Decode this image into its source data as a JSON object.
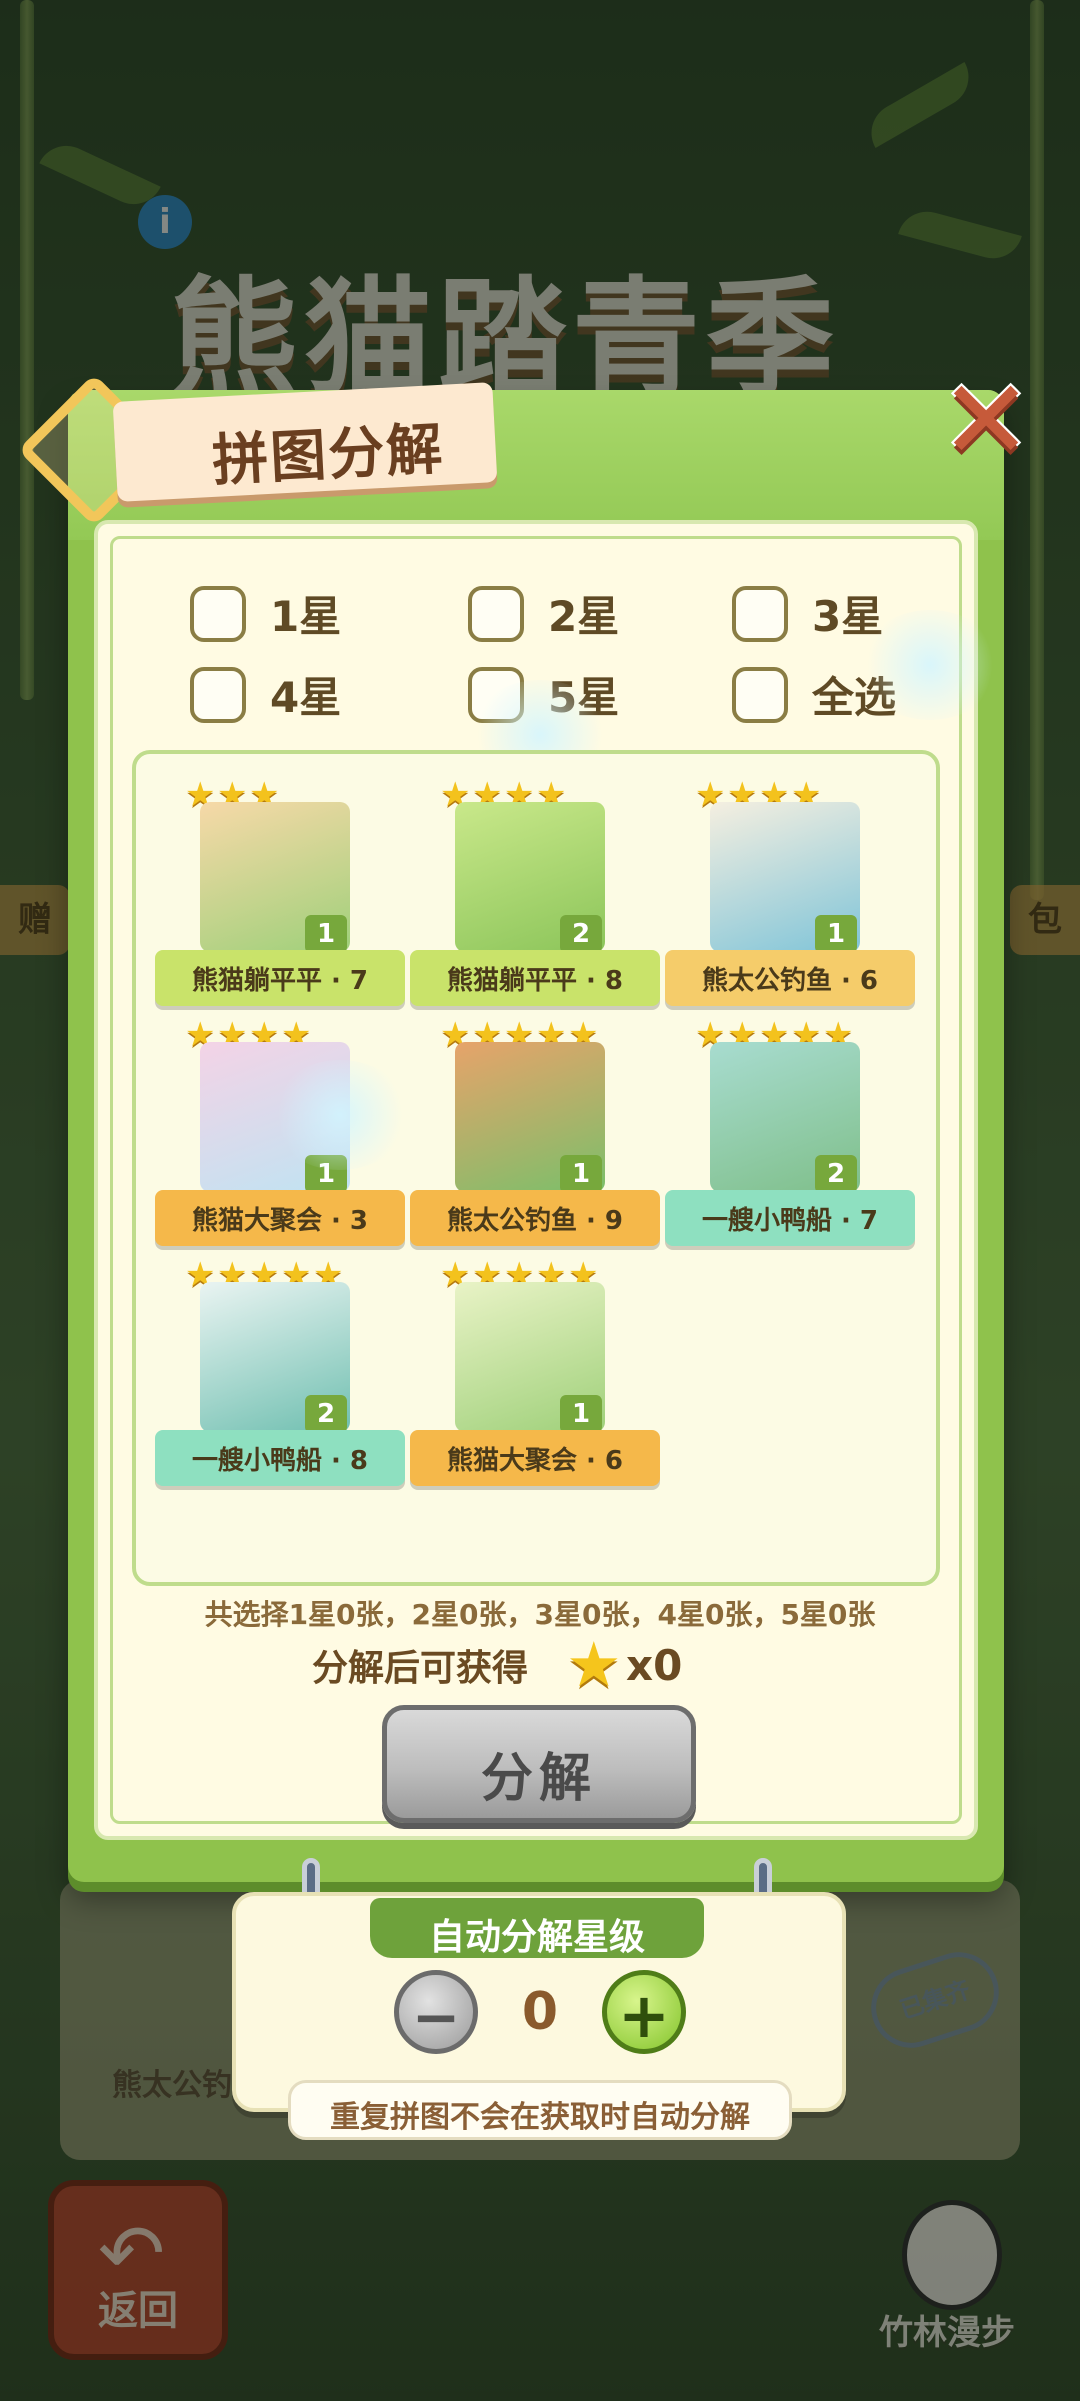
{
  "background": {
    "game_title": "熊猫踏青季",
    "info_icon": "info-icon",
    "left_side_label": "赠",
    "right_side_label": "包",
    "stamp_text": "已集齐",
    "card_label": "熊太公钓"
  },
  "dialog": {
    "title": "拼图分解",
    "close_icon": "close-x-icon",
    "filters": [
      {
        "label": "1星",
        "checked": false
      },
      {
        "label": "2星",
        "checked": false
      },
      {
        "label": "3星",
        "checked": false
      },
      {
        "label": "4星",
        "checked": false
      },
      {
        "label": "5星",
        "checked": false
      },
      {
        "label": "全选",
        "checked": false
      }
    ],
    "cards": [
      {
        "name": "熊猫躺平平 · 7",
        "stars": 3,
        "count": "1",
        "ribbon": "#c9e36a"
      },
      {
        "name": "熊猫躺平平 · 8",
        "stars": 4,
        "count": "2",
        "ribbon": "#c9e36a"
      },
      {
        "name": "熊太公钓鱼 · 6",
        "stars": 4,
        "count": "1",
        "ribbon": "#f5cc6a"
      },
      {
        "name": "熊猫大聚会 · 3",
        "stars": 4,
        "count": "1",
        "ribbon": "#f5b84a"
      },
      {
        "name": "熊太公钓鱼 · 9",
        "stars": 5,
        "count": "1",
        "ribbon": "#f5b84a"
      },
      {
        "name": "一艘小鸭船 · 7",
        "stars": 5,
        "count": "2",
        "ribbon": "#8ee0c0"
      },
      {
        "name": "一艘小鸭船 · 8",
        "stars": 5,
        "count": "2",
        "ribbon": "#8ee0c0"
      },
      {
        "name": "熊猫大聚会 · 6",
        "stars": 5,
        "count": "1",
        "ribbon": "#f5b84a"
      }
    ],
    "summary": "共选择1星0张，2星0张，3星0张，4星0张，5星0张",
    "gain_label": "分解后可获得",
    "gain_icon": "star-icon",
    "gain_value": "x0",
    "decompose_button": "分解"
  },
  "auto_decompose": {
    "title": "自动分解星级",
    "value": "0",
    "minus_icon": "minus-icon",
    "plus_icon": "plus-icon",
    "note": "重复拼图不会在获取时自动分解"
  },
  "footer": {
    "back_label": "返回",
    "walk_label": "竹林漫步"
  }
}
